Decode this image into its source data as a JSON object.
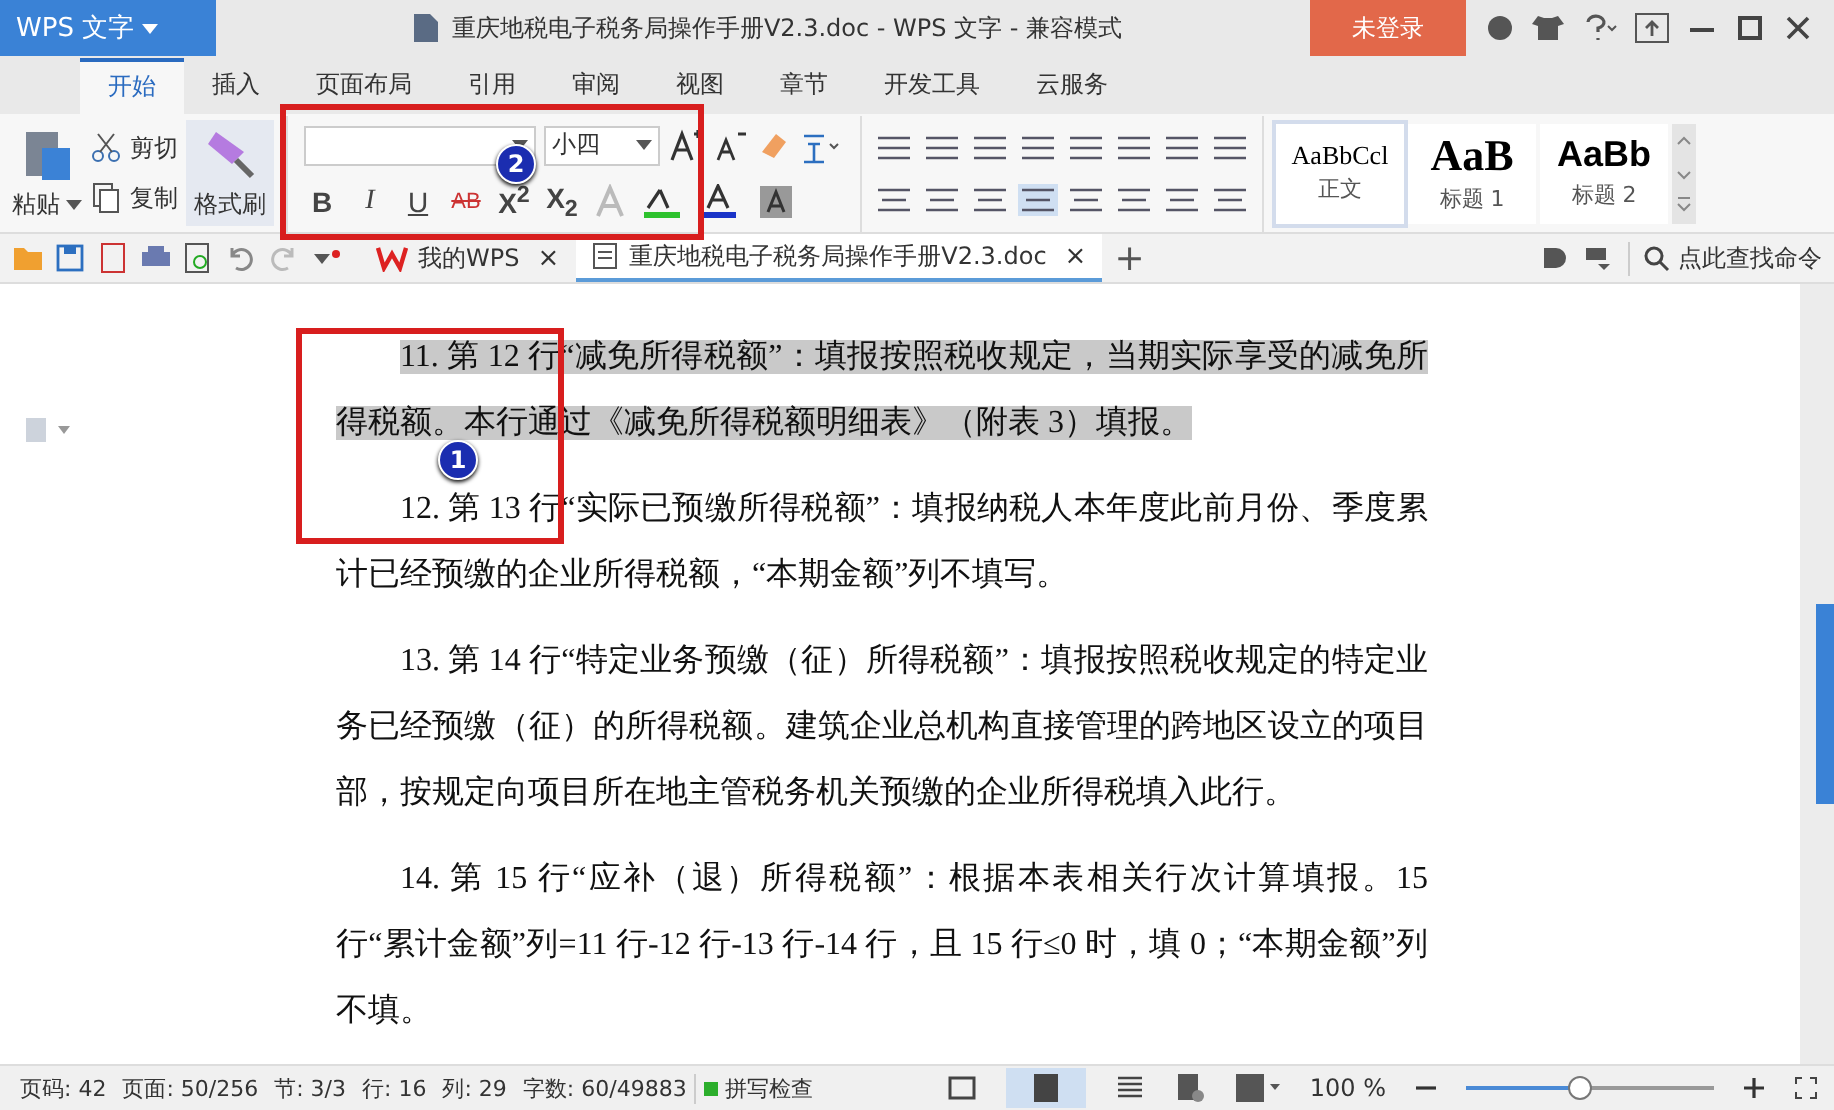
{
  "app_menu": {
    "label": "WPS 文字"
  },
  "window": {
    "title": "重庆地税电子税务局操作手册V2.3.doc - WPS 文字 - 兼容模式",
    "login_button": "未登录"
  },
  "ribbon_tabs": [
    {
      "label": "开始",
      "selected": true
    },
    {
      "label": "插入",
      "selected": false
    },
    {
      "label": "页面布局",
      "selected": false
    },
    {
      "label": "引用",
      "selected": false
    },
    {
      "label": "审阅",
      "selected": false
    },
    {
      "label": "视图",
      "selected": false
    },
    {
      "label": "章节",
      "selected": false
    },
    {
      "label": "开发工具",
      "selected": false
    },
    {
      "label": "云服务",
      "selected": false
    }
  ],
  "clipboard": {
    "paste": "粘贴",
    "cut": "剪切",
    "copy": "复制",
    "format_painter": "格式刷"
  },
  "font": {
    "size": "小四",
    "format_buttons": [
      {
        "kind": "bold",
        "label": "B"
      },
      {
        "kind": "italic",
        "label": "I"
      },
      {
        "kind": "underline",
        "label": "U"
      },
      {
        "kind": "strike",
        "label": "AB"
      },
      {
        "kind": "superscript",
        "label": "X$^{2}$"
      },
      {
        "kind": "subscript",
        "label": "X$_{2}$"
      }
    ]
  },
  "styles": [
    {
      "preview": "AaBbCcl",
      "name": "正文",
      "selected": true,
      "kind": "serif"
    },
    {
      "preview": "AaB",
      "name": "标题 1",
      "selected": false,
      "kind": "heading1"
    },
    {
      "preview": "AaBb",
      "name": "标题 2",
      "selected": false,
      "kind": "heading2"
    }
  ],
  "doc_tabs": [
    {
      "label": "我的WPS",
      "selected": false,
      "kind": "home",
      "close": "×"
    },
    {
      "label": "重庆地税电子税务局操作手册V2.3.doc",
      "selected": true,
      "kind": "doc",
      "close": "×"
    }
  ],
  "new_tab": "+",
  "command_search": {
    "placeholder": "点此查找命令"
  },
  "paragraphs": [
    {
      "text": "11. 第 12 行“减免所得税额”：填报按照税收规定，当期实际享受的减免所得税额。本行通过《减免所得税额明细表》（附表 3）填报。",
      "selected": true
    },
    {
      "text": "12. 第 13 行“实际已预缴所得税额”：填报纳税人本年度此前月份、季度累计已经预缴的企业所得税额，“本期金额”列不填写。",
      "selected": false
    },
    {
      "text": "13. 第 14 行“特定业务预缴（征）所得税额”：填报按照税收规定的特定业务已经预缴（征）的所得税额。建筑企业总机构直接管理的跨地区设立的项目部，按规定向项目所在地主管税务机关预缴的企业所得税填入此行。",
      "selected": false
    },
    {
      "text": "14. 第 15 行“应补（退）所得税额”：根据本表相关行次计算填报。15 行“累计金额”列=11 行-12 行-13 行-14 行，且 15 行≤0 时，填 0；“本期金额”列不填。",
      "selected": false
    }
  ],
  "annotations": [
    {
      "label": "1"
    },
    {
      "label": "2"
    }
  ],
  "status_bar": {
    "items": [
      "页码: 42",
      "页面: 50/256",
      "节: 3/3",
      "行: 16",
      "列: 29",
      "字数: 60/49883"
    ],
    "spell_check": "拼写检查",
    "zoom": "100 %",
    "zoom_level": {
      "level": 0.46
    }
  }
}
